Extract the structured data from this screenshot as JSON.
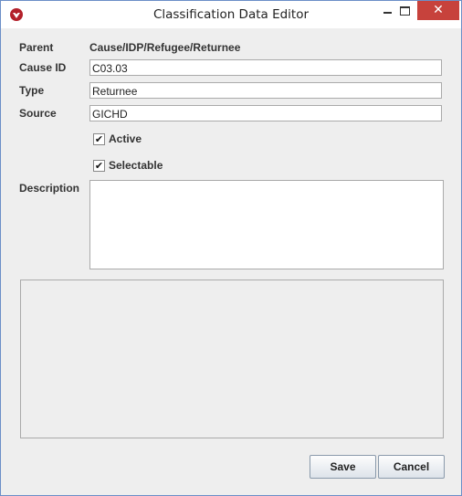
{
  "window": {
    "title": "Classification Data Editor",
    "icons": {
      "app": "app-logo-icon",
      "minimize": "minimize-icon",
      "maximize": "maximize-icon",
      "close": "close-icon"
    },
    "close_glyph": "✕"
  },
  "form": {
    "parent_label": "Parent",
    "parent_value": "Cause/IDP/Refugee/Returnee",
    "cause_id_label": "Cause ID",
    "cause_id_value": "C03.03",
    "type_label": "Type",
    "type_value": "Returnee",
    "source_label": "Source",
    "source_value": "GICHD",
    "active_label": "Active",
    "active_checked": true,
    "selectable_label": "Selectable",
    "selectable_checked": true,
    "description_label": "Description",
    "description_value": ""
  },
  "buttons": {
    "save": "Save",
    "cancel": "Cancel"
  },
  "colors": {
    "close_button": "#c7423c",
    "window_border": "#6b8fc7",
    "background": "#eeeeee"
  }
}
